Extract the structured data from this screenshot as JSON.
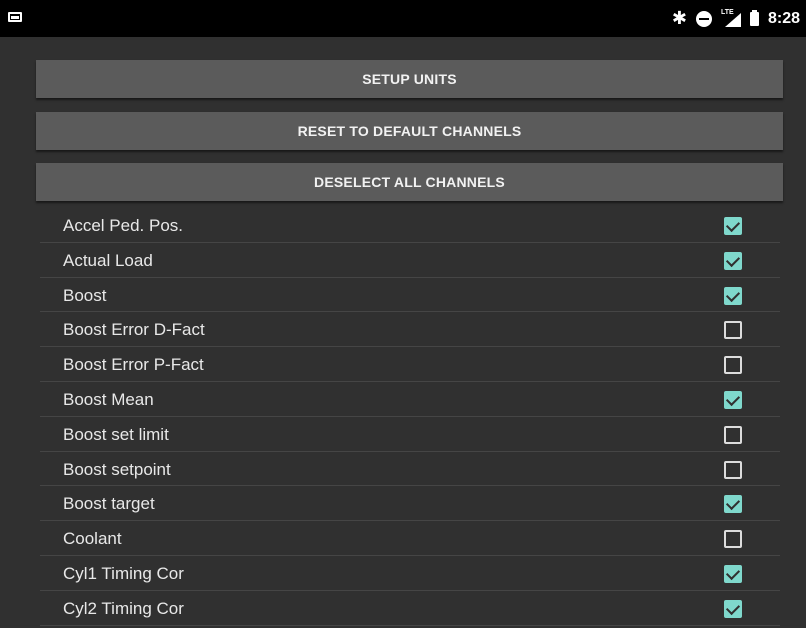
{
  "status_bar": {
    "left_icon": "image-icon",
    "icons": [
      "bluetooth-icon",
      "do-not-disturb-icon",
      "lte-signal-icon",
      "battery-icon"
    ],
    "lte_label": "LTE",
    "time": "8:28"
  },
  "buttons": {
    "setup_units": "SETUP UNITS",
    "reset_default": "RESET TO DEFAULT CHANNELS",
    "deselect_all": "DESELECT ALL CHANNELS"
  },
  "colors": {
    "background": "#303030",
    "button": "#5b5b5b",
    "checkbox_checked": "#7fd8cc"
  },
  "channels": [
    {
      "label": "Accel Ped. Pos.",
      "checked": true
    },
    {
      "label": "Actual Load",
      "checked": true
    },
    {
      "label": "Boost",
      "checked": true
    },
    {
      "label": "Boost Error D-Fact",
      "checked": false
    },
    {
      "label": "Boost Error P-Fact",
      "checked": false
    },
    {
      "label": "Boost Mean",
      "checked": true
    },
    {
      "label": "Boost set limit",
      "checked": false
    },
    {
      "label": "Boost setpoint",
      "checked": false
    },
    {
      "label": "Boost target",
      "checked": true
    },
    {
      "label": "Coolant",
      "checked": false
    },
    {
      "label": "Cyl1 Timing Cor",
      "checked": true
    },
    {
      "label": "Cyl2 Timing Cor",
      "checked": true
    }
  ]
}
